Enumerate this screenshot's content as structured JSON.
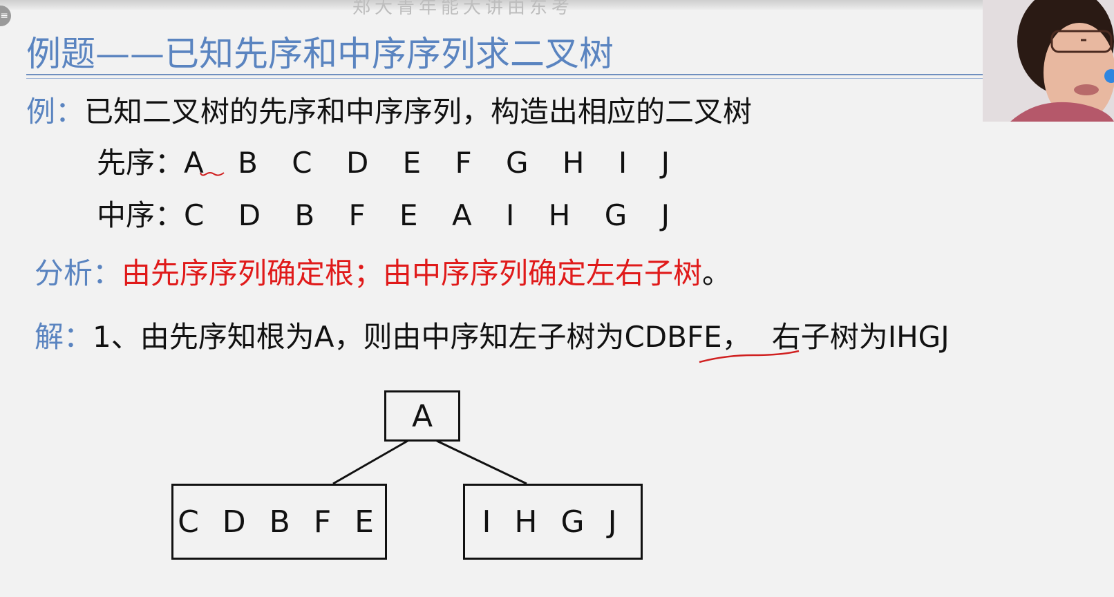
{
  "top_caption": "郑大青年能大讲由东考",
  "title": "例题——已知先序和中序序列求二叉树",
  "example": {
    "label": "例：",
    "text": "已知二叉树的先序和中序序列，构造出相应的二叉树"
  },
  "preorder": {
    "label": "先序：",
    "sequence": "A B C D E F G H I J"
  },
  "inorder": {
    "label": "中序：",
    "sequence": "C D B F E A I H G J"
  },
  "analysis": {
    "label": "分析：",
    "text": "由先序序列确定根；由中序序列确定左右子树",
    "period": "。"
  },
  "solution": {
    "label": "解：",
    "prefix": "1、由先序知根为A，则由中序知左子树为",
    "left": "CDBFE",
    "comma": "，",
    "suffix": "右子树为IHGJ"
  },
  "tree": {
    "root": "A",
    "left": "C D B F E",
    "right": "I H G J"
  },
  "colors": {
    "title": "#5a84c0",
    "emphasis": "#e01a1a",
    "annotation": "#d02020"
  }
}
